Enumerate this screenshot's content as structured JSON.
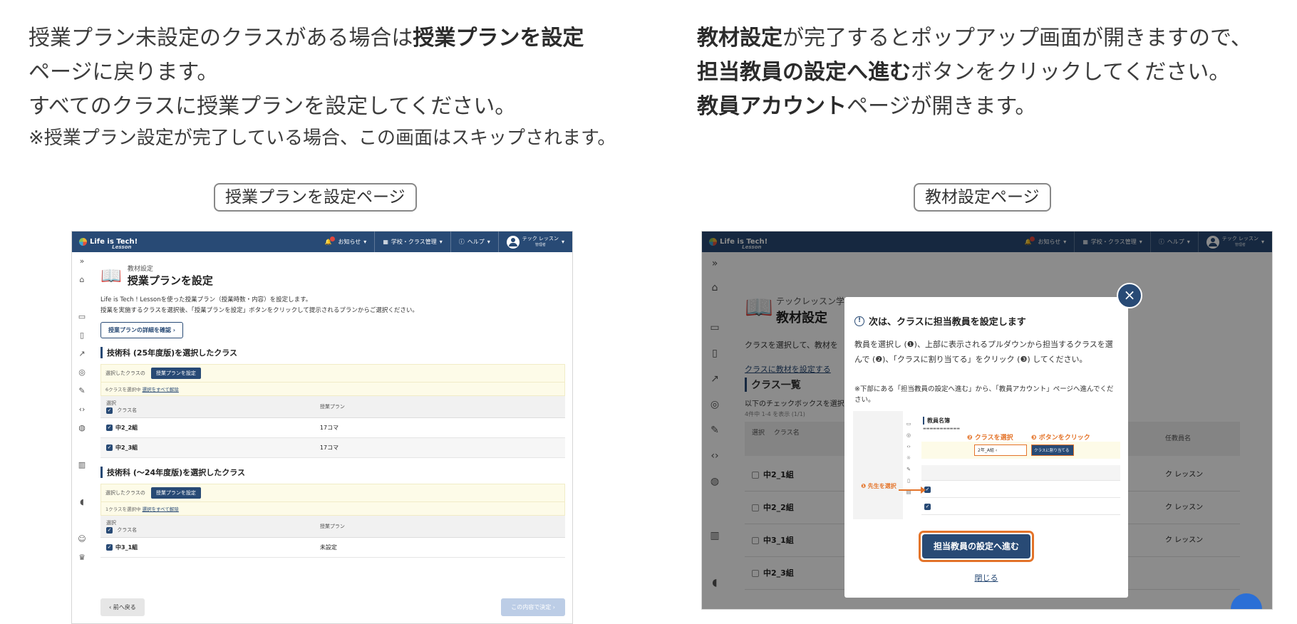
{
  "left_text": {
    "line1_pre": "授業プラン未設定のクラスがある場合は",
    "line1_bold": "授業プランを設定",
    "line2": "ページに戻ります。",
    "line3": "すべてのクラスに授業プランを設定してください。",
    "line4": "※授業プラン設定が完了している場合、この画面はスキップされます。"
  },
  "right_text": {
    "line1_bold": "教材設定",
    "line1_post": "が完了するとポップアップ画面が開きますので、",
    "line2_bold": "担当教員の設定へ進む",
    "line2_post": "ボタンをクリックしてください。",
    "line3_bold": "教員アカウント",
    "line3_post": "ページが開きます。"
  },
  "captions": {
    "left": "授業プランを設定ページ",
    "right": "教材設定ページ"
  },
  "appbar": {
    "logo": "Life is Tech!",
    "logo_sub": "Lesson",
    "news": "お知らせ",
    "school": "学校・クラス管理",
    "help": "ヘルプ",
    "user": "テック レッスン",
    "role": "管理者"
  },
  "left_shot": {
    "breadcrumb": "教材設定",
    "title": "授業プランを設定",
    "desc1": "Life is Tech ! Lessonを使った授業プラン（授業時数・内容）を設定します。",
    "desc2": "授業を実施するクラスを選択後、「授業プランを設定」ボタンをクリックして提示されるプランからご選択ください。",
    "detail_button": "授業プランの詳細を確認 ›",
    "section1": "技術科 (25年度版)を選択したクラス",
    "section2": "技術科 (〜24年度版)を選択したクラス",
    "selected_label": "選択したクラスの",
    "set_plan_button": "授業プランを設定",
    "count1": "6クラスを選択中",
    "count2": "1クラスを選択中",
    "deselect_all": "選択をすべて解除",
    "col_select": "選択",
    "col_class": "クラス名",
    "col_plan": "授業プラン",
    "rows1": [
      {
        "name": "中2_2組",
        "plan": "17コマ"
      },
      {
        "name": "中2_3組",
        "plan": "17コマ"
      }
    ],
    "rows2": [
      {
        "name": "中3_1組",
        "plan": "未設定"
      }
    ],
    "back_button": "‹ 前へ戻る",
    "next_button": "この内容で決定 ›"
  },
  "right_shot": {
    "school_name": "テックレッスン学園",
    "title": "教材設定",
    "bg_desc": "クラスを選択して、教材を",
    "bg_link": "クラスに教材を設定する",
    "bg_section": "クラス一覧",
    "bg_hint": "以下のチェックボックスを選択す",
    "bg_count": "4件中 1-4 を表示 (1/1)",
    "bg_col_select": "選択",
    "bg_col_class": "クラス名",
    "bg_col_teacher": "任教員名",
    "bg_rows": [
      {
        "name": "中2_1組",
        "teacher": "ク レッスン"
      },
      {
        "name": "中2_2組",
        "teacher": "ク レッスン"
      },
      {
        "name": "中3_1組",
        "teacher": "ク レッスン"
      },
      {
        "name": "中2_3組",
        "teacher": ""
      }
    ],
    "modal": {
      "heading": "次は、クラスに担当教員を設定します",
      "body": "教員を選択し (❶)、上部に表示されるプルダウンから担当するクラスを選んで (❷)、「クラスに割り当てる」をクリック (❸) してください。",
      "note": "※下部にある「担当教員の設定へ進む」から、「教員アカウント」ページへ進んでください。",
      "img_title": "教員名簿",
      "step1": "❶ 先生を選択",
      "step2": "❷ クラスを選択",
      "step3": "❸ ボタンをクリック",
      "img_select": "2年_A組",
      "img_assign": "クラスに割り当てる",
      "primary_button": "担当教員の設定へ進む",
      "close_link": "閉じる"
    }
  },
  "colors": {
    "navy": "#284a75",
    "orange": "#e4742a",
    "warn_red": "#d64545"
  }
}
